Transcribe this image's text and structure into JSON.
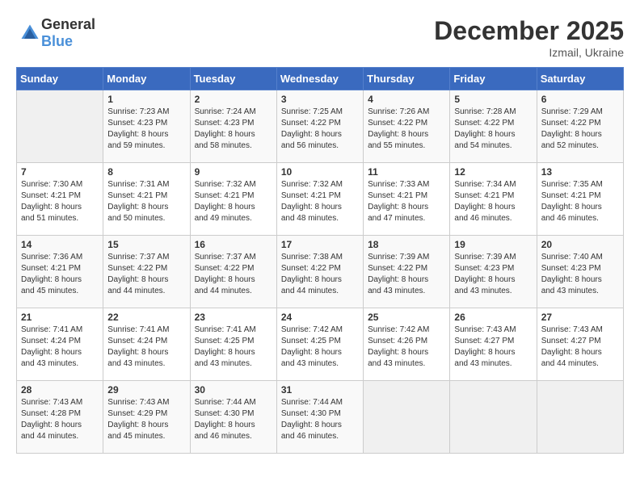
{
  "header": {
    "logo_general": "General",
    "logo_blue": "Blue",
    "title": "December 2025",
    "location": "Izmail, Ukraine"
  },
  "days_of_week": [
    "Sunday",
    "Monday",
    "Tuesday",
    "Wednesday",
    "Thursday",
    "Friday",
    "Saturday"
  ],
  "weeks": [
    [
      {
        "day": "",
        "info": ""
      },
      {
        "day": "1",
        "info": "Sunrise: 7:23 AM\nSunset: 4:23 PM\nDaylight: 8 hours\nand 59 minutes."
      },
      {
        "day": "2",
        "info": "Sunrise: 7:24 AM\nSunset: 4:23 PM\nDaylight: 8 hours\nand 58 minutes."
      },
      {
        "day": "3",
        "info": "Sunrise: 7:25 AM\nSunset: 4:22 PM\nDaylight: 8 hours\nand 56 minutes."
      },
      {
        "day": "4",
        "info": "Sunrise: 7:26 AM\nSunset: 4:22 PM\nDaylight: 8 hours\nand 55 minutes."
      },
      {
        "day": "5",
        "info": "Sunrise: 7:28 AM\nSunset: 4:22 PM\nDaylight: 8 hours\nand 54 minutes."
      },
      {
        "day": "6",
        "info": "Sunrise: 7:29 AM\nSunset: 4:22 PM\nDaylight: 8 hours\nand 52 minutes."
      }
    ],
    [
      {
        "day": "7",
        "info": "Sunrise: 7:30 AM\nSunset: 4:21 PM\nDaylight: 8 hours\nand 51 minutes."
      },
      {
        "day": "8",
        "info": "Sunrise: 7:31 AM\nSunset: 4:21 PM\nDaylight: 8 hours\nand 50 minutes."
      },
      {
        "day": "9",
        "info": "Sunrise: 7:32 AM\nSunset: 4:21 PM\nDaylight: 8 hours\nand 49 minutes."
      },
      {
        "day": "10",
        "info": "Sunrise: 7:32 AM\nSunset: 4:21 PM\nDaylight: 8 hours\nand 48 minutes."
      },
      {
        "day": "11",
        "info": "Sunrise: 7:33 AM\nSunset: 4:21 PM\nDaylight: 8 hours\nand 47 minutes."
      },
      {
        "day": "12",
        "info": "Sunrise: 7:34 AM\nSunset: 4:21 PM\nDaylight: 8 hours\nand 46 minutes."
      },
      {
        "day": "13",
        "info": "Sunrise: 7:35 AM\nSunset: 4:21 PM\nDaylight: 8 hours\nand 46 minutes."
      }
    ],
    [
      {
        "day": "14",
        "info": "Sunrise: 7:36 AM\nSunset: 4:21 PM\nDaylight: 8 hours\nand 45 minutes."
      },
      {
        "day": "15",
        "info": "Sunrise: 7:37 AM\nSunset: 4:22 PM\nDaylight: 8 hours\nand 44 minutes."
      },
      {
        "day": "16",
        "info": "Sunrise: 7:37 AM\nSunset: 4:22 PM\nDaylight: 8 hours\nand 44 minutes."
      },
      {
        "day": "17",
        "info": "Sunrise: 7:38 AM\nSunset: 4:22 PM\nDaylight: 8 hours\nand 44 minutes."
      },
      {
        "day": "18",
        "info": "Sunrise: 7:39 AM\nSunset: 4:22 PM\nDaylight: 8 hours\nand 43 minutes."
      },
      {
        "day": "19",
        "info": "Sunrise: 7:39 AM\nSunset: 4:23 PM\nDaylight: 8 hours\nand 43 minutes."
      },
      {
        "day": "20",
        "info": "Sunrise: 7:40 AM\nSunset: 4:23 PM\nDaylight: 8 hours\nand 43 minutes."
      }
    ],
    [
      {
        "day": "21",
        "info": "Sunrise: 7:41 AM\nSunset: 4:24 PM\nDaylight: 8 hours\nand 43 minutes."
      },
      {
        "day": "22",
        "info": "Sunrise: 7:41 AM\nSunset: 4:24 PM\nDaylight: 8 hours\nand 43 minutes."
      },
      {
        "day": "23",
        "info": "Sunrise: 7:41 AM\nSunset: 4:25 PM\nDaylight: 8 hours\nand 43 minutes."
      },
      {
        "day": "24",
        "info": "Sunrise: 7:42 AM\nSunset: 4:25 PM\nDaylight: 8 hours\nand 43 minutes."
      },
      {
        "day": "25",
        "info": "Sunrise: 7:42 AM\nSunset: 4:26 PM\nDaylight: 8 hours\nand 43 minutes."
      },
      {
        "day": "26",
        "info": "Sunrise: 7:43 AM\nSunset: 4:27 PM\nDaylight: 8 hours\nand 43 minutes."
      },
      {
        "day": "27",
        "info": "Sunrise: 7:43 AM\nSunset: 4:27 PM\nDaylight: 8 hours\nand 44 minutes."
      }
    ],
    [
      {
        "day": "28",
        "info": "Sunrise: 7:43 AM\nSunset: 4:28 PM\nDaylight: 8 hours\nand 44 minutes."
      },
      {
        "day": "29",
        "info": "Sunrise: 7:43 AM\nSunset: 4:29 PM\nDaylight: 8 hours\nand 45 minutes."
      },
      {
        "day": "30",
        "info": "Sunrise: 7:44 AM\nSunset: 4:30 PM\nDaylight: 8 hours\nand 46 minutes."
      },
      {
        "day": "31",
        "info": "Sunrise: 7:44 AM\nSunset: 4:30 PM\nDaylight: 8 hours\nand 46 minutes."
      },
      {
        "day": "",
        "info": ""
      },
      {
        "day": "",
        "info": ""
      },
      {
        "day": "",
        "info": ""
      }
    ]
  ]
}
